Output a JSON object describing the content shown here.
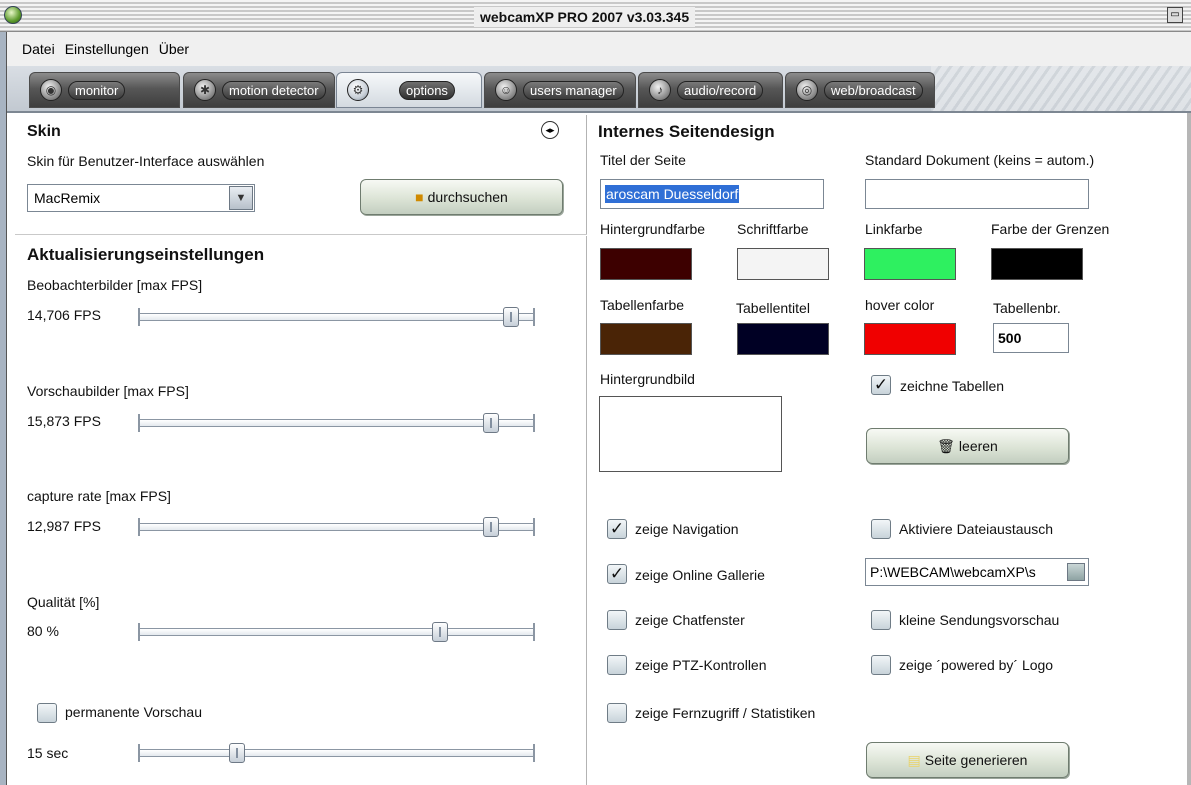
{
  "window": {
    "title": "webcamXP PRO 2007 v3.03.345"
  },
  "menu": {
    "items": [
      "Datei",
      "Einstellungen",
      "Über"
    ]
  },
  "tabs": [
    {
      "label": "monitor",
      "icon": "webcam-icon"
    },
    {
      "label": "motion detector",
      "icon": "bug-icon"
    },
    {
      "label": "options",
      "icon": "gear-icon",
      "active": true
    },
    {
      "label": "users manager",
      "icon": "users-icon"
    },
    {
      "label": "audio/record",
      "icon": "speaker-icon"
    },
    {
      "label": "web/broadcast",
      "icon": "broadcast-icon"
    }
  ],
  "skin": {
    "title": "Skin",
    "description": "Skin für Benutzer-Interface auswählen",
    "selected": "MacRemix",
    "browse_label": "durchsuchen"
  },
  "update": {
    "title": "Aktualisierungseinstellungen",
    "sliders": [
      {
        "label": "Beobachterbilder [max FPS]",
        "value_text": "14,706 FPS",
        "level": 0.94
      },
      {
        "label": "Vorschaubilder [max FPS]",
        "value_text": "15,873 FPS",
        "level": 0.89
      },
      {
        "label": "capture rate [max FPS]",
        "value_text": "12,987 FPS",
        "level": 0.89
      },
      {
        "label": "Qualität [%]",
        "value_text": "80 %",
        "level": 0.76
      }
    ],
    "permanent_preview": {
      "label": "permanente Vorschau",
      "checked": false
    },
    "preview_interval": {
      "value_text": "15 sec",
      "level": 0.25
    }
  },
  "design": {
    "title": "Internes Seitendesign",
    "page_title_label": "Titel der Seite",
    "page_title_value": "aroscam Duesseldorf",
    "default_doc_label": "Standard Dokument (keins = autom.)",
    "default_doc_value": "",
    "colors": [
      {
        "label": "Hintergrundfarbe",
        "color": "#3d0000"
      },
      {
        "label": "Schriftfarbe",
        "color": "#f4f4f4"
      },
      {
        "label": "Linkfarbe",
        "color": "#2ef060"
      },
      {
        "label": "Farbe der Grenzen",
        "color": "#000000"
      },
      {
        "label": "Tabellenfarbe",
        "color": "#4a2406"
      },
      {
        "label": "Tabellentitel",
        "color": "#000024"
      },
      {
        "label": "hover color",
        "color": "#f00000"
      }
    ],
    "table_width_label": "Tabellenbr.",
    "table_width_value": "500",
    "bg_image_label": "Hintergrundbild",
    "draw_tables": {
      "label": "zeichne Tabellen",
      "checked": true
    },
    "clear_label": "leeren",
    "options_left": [
      {
        "label": "zeige Navigation",
        "checked": true
      },
      {
        "label": "zeige Online Gallerie",
        "checked": true
      },
      {
        "label": "zeige Chatfenster",
        "checked": false
      },
      {
        "label": "zeige PTZ-Kontrollen",
        "checked": false
      },
      {
        "label": "zeige Fernzugriff / Statistiken",
        "checked": false
      }
    ],
    "options_right": [
      {
        "label": "Aktiviere Dateiaustausch",
        "checked": false
      },
      {
        "label": "kleine Sendungsvorschau",
        "checked": false
      },
      {
        "label": "zeige ´powered by´ Logo",
        "checked": false
      }
    ],
    "share_path": "P:\\WEBCAM\\webcamXP\\s",
    "generate_label": "Seite generieren"
  }
}
